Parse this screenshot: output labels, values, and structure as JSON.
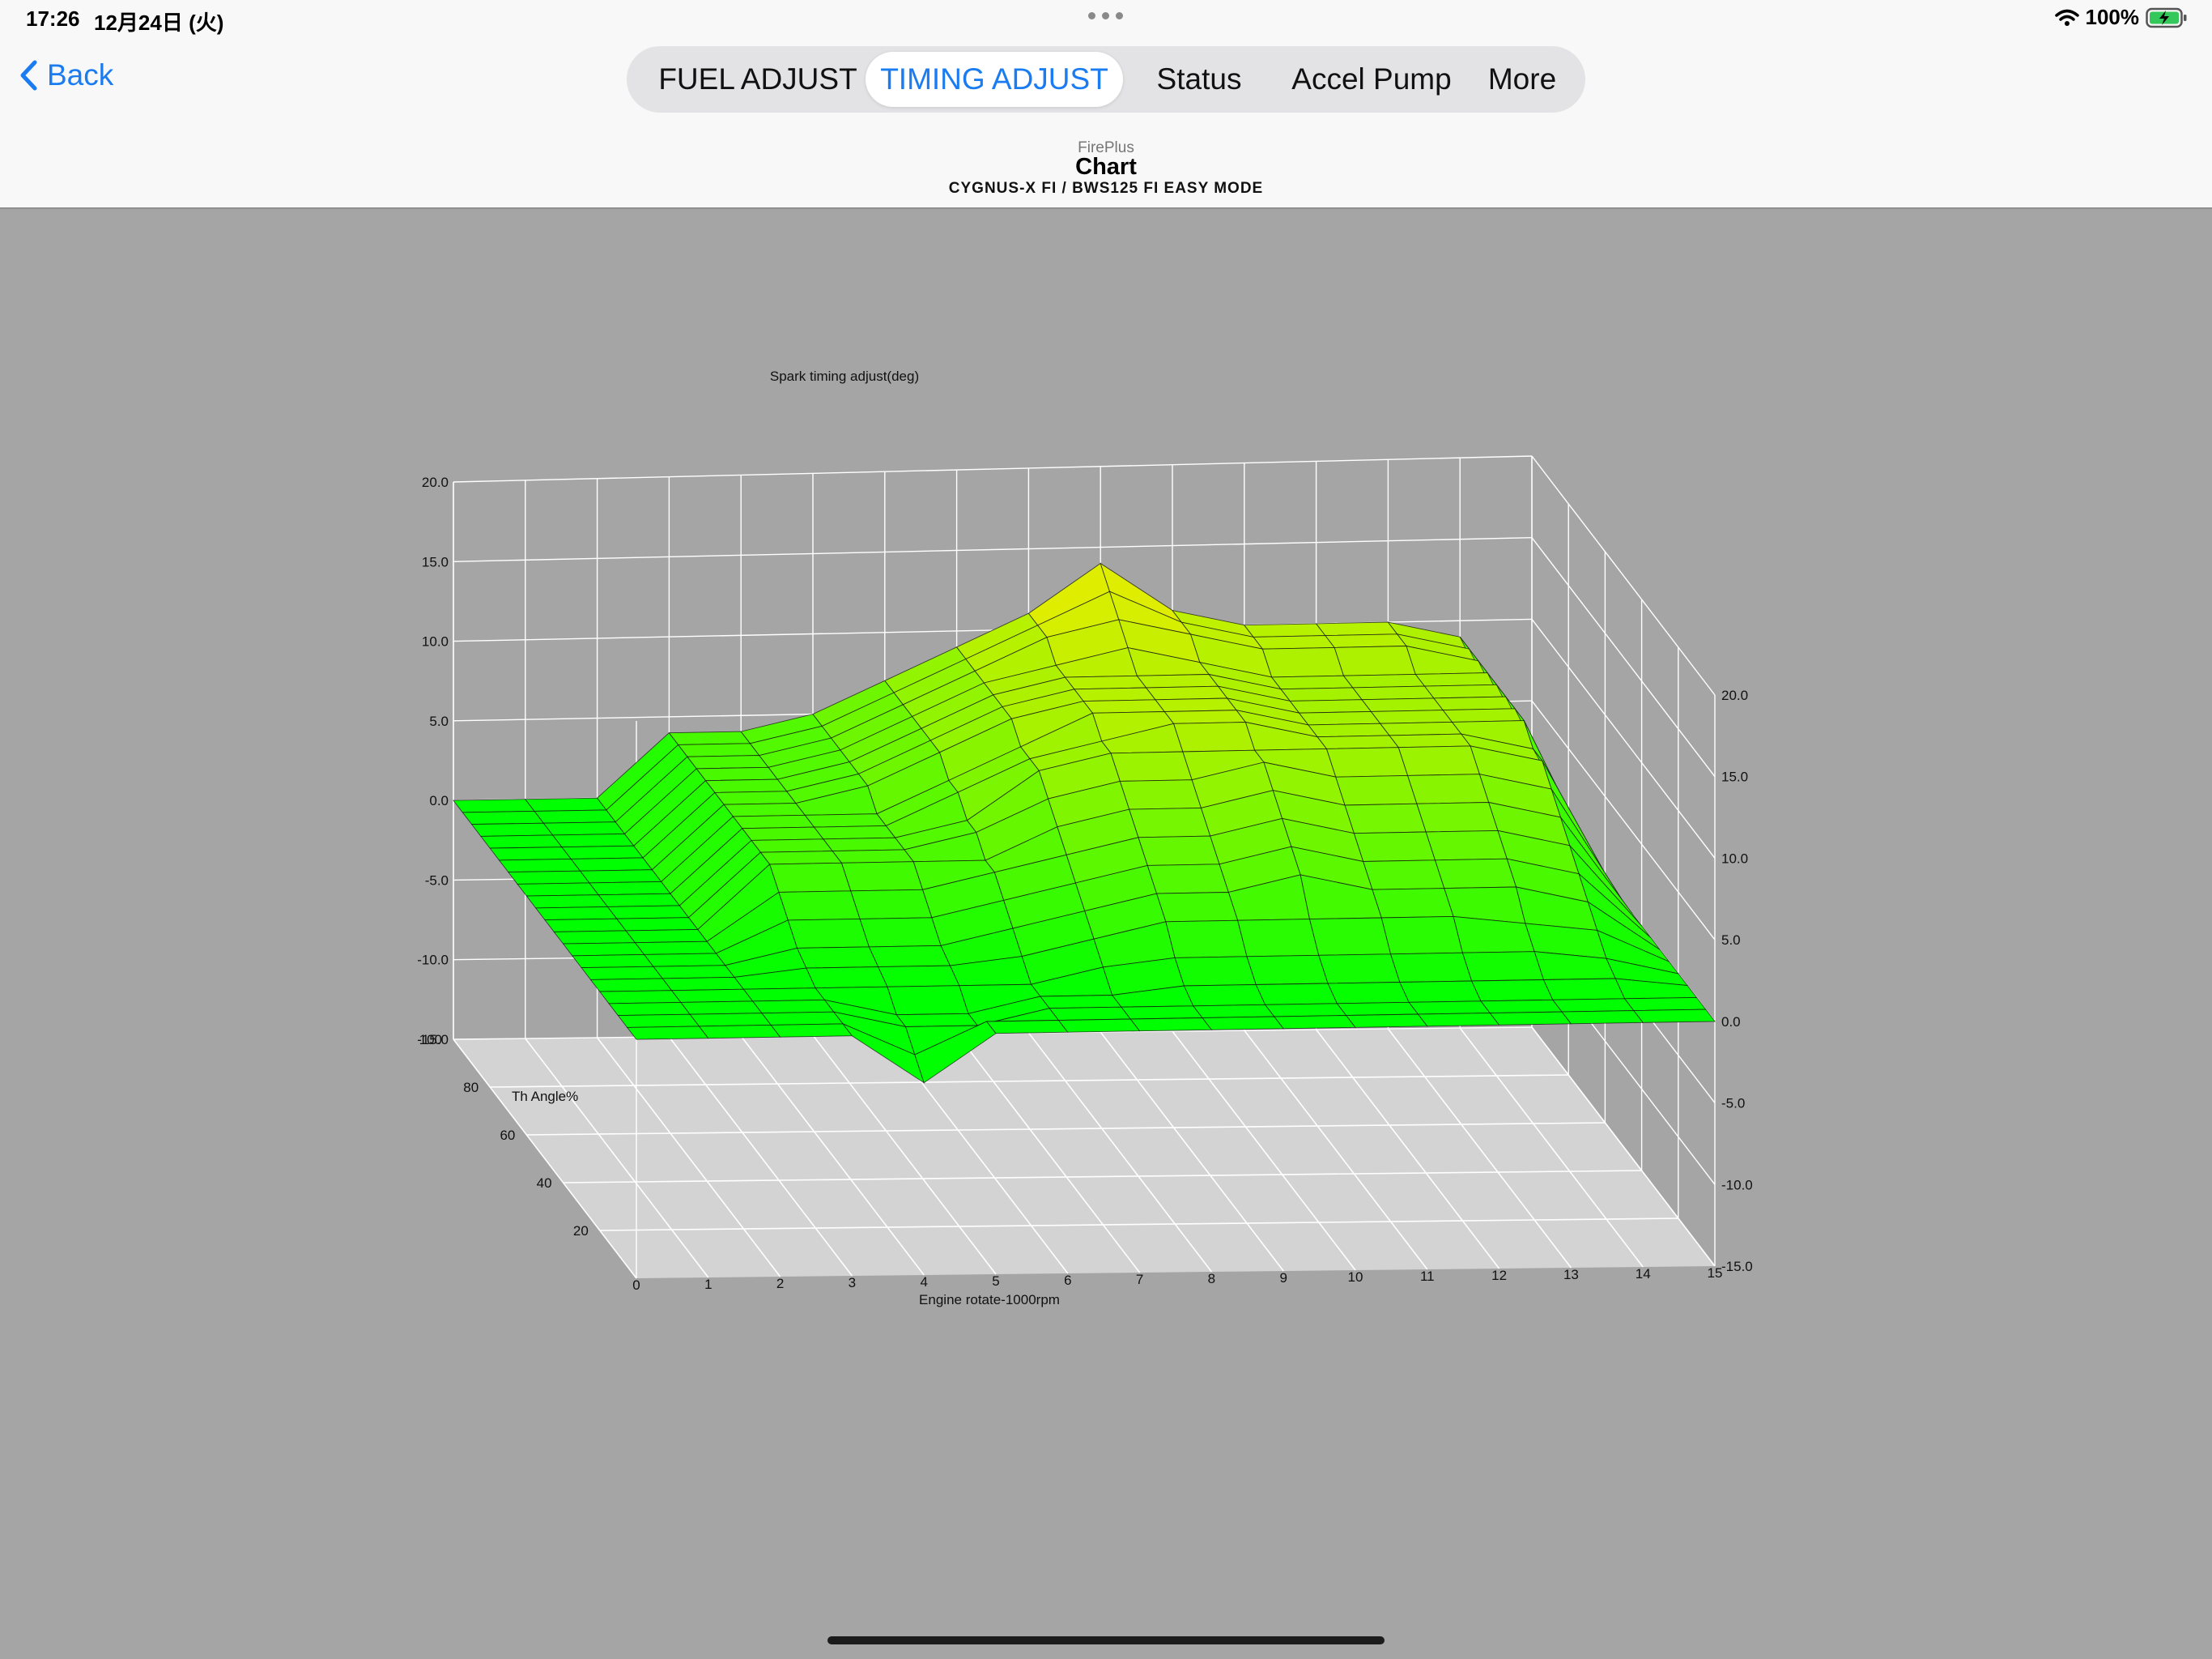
{
  "status_bar": {
    "time": "17:26",
    "date": "12月24日 (火)",
    "battery": "100%"
  },
  "nav": {
    "back_label": "Back",
    "tabs": [
      {
        "label": "FUEL ADJUST",
        "active": false
      },
      {
        "label": "TIMING ADJUST",
        "active": true
      },
      {
        "label": "Status",
        "active": false
      },
      {
        "label": "Accel Pump",
        "active": false
      },
      {
        "label": "More",
        "active": false
      }
    ]
  },
  "header": {
    "app_name": "FirePlus",
    "title": "Chart",
    "subtitle": "CYGNUS-X FI / BWS125 FI EASY MODE"
  },
  "colors": {
    "accent": "#1a7cf0",
    "surface_low": "#00ff00",
    "surface_high": "#ffee00",
    "background": "#a5a5a5"
  },
  "chart_data": {
    "type": "surface3d",
    "title": "Spark timing adjust(deg)",
    "xlabel": "Engine rotate-1000rpm",
    "ylabel": "Th Angle%",
    "zlabel": "",
    "x_ticks": [
      "0",
      "1",
      "2",
      "3",
      "4",
      "5",
      "6",
      "7",
      "8",
      "9",
      "10",
      "11",
      "12",
      "13",
      "14",
      "15"
    ],
    "y_ticks": [
      "20",
      "40",
      "60",
      "80",
      "100"
    ],
    "z_ticks_left": [
      "-15.0",
      "-10.0",
      "-5.0",
      "0.0",
      "5.0",
      "10.0",
      "15.0",
      "20.0"
    ],
    "z_ticks_right": [
      "-15.0",
      "-10.0",
      "-5.0",
      "0.0",
      "5.0",
      "10.0",
      "15.0",
      "20.0"
    ],
    "xlim": [
      0,
      15
    ],
    "ylim": [
      0,
      100
    ],
    "zlim": [
      -15,
      20
    ],
    "grid": true,
    "x": [
      0,
      1,
      2,
      3,
      4,
      5,
      6,
      7,
      8,
      9,
      10,
      11,
      12,
      13,
      14,
      15
    ],
    "y": [
      0,
      5,
      10,
      15,
      20,
      25,
      30,
      35,
      40,
      45,
      50,
      55,
      60,
      65,
      70,
      75,
      80,
      85,
      90,
      95,
      100
    ],
    "z_rows": [
      [
        0,
        0,
        0,
        0,
        -3,
        0,
        0,
        0,
        0,
        0,
        0,
        0,
        0,
        0,
        0,
        0
      ],
      [
        0,
        0,
        0,
        0,
        -2,
        0,
        0,
        0,
        0,
        0,
        0,
        0,
        0,
        0,
        0,
        0
      ],
      [
        0,
        0,
        0,
        0,
        -1,
        -1,
        0,
        0,
        0,
        0,
        0,
        0,
        0,
        0,
        0,
        0
      ],
      [
        0,
        0,
        0,
        0,
        -1,
        -1,
        0,
        0,
        0.5,
        0.5,
        0.5,
        0.5,
        0.5,
        0.5,
        0.5,
        0
      ],
      [
        0,
        0,
        0,
        0,
        0,
        0,
        0,
        1,
        1.5,
        1.5,
        1.5,
        1.5,
        1.5,
        1.5,
        1,
        0
      ],
      [
        0,
        0,
        0,
        0.5,
        0.5,
        0.5,
        1,
        2,
        3,
        3,
        3,
        3,
        3,
        2.5,
        2,
        0
      ],
      [
        0,
        0,
        0,
        1,
        1,
        1,
        2,
        3,
        4,
        4,
        5,
        4,
        4,
        4,
        3,
        0
      ],
      [
        0,
        0,
        0,
        2,
        2,
        2,
        3,
        4,
        5,
        5,
        6,
        5,
        5,
        5,
        4,
        0
      ],
      [
        0,
        0,
        0,
        3,
        3,
        3,
        4,
        5,
        6,
        6,
        7,
        6,
        6,
        6,
        5,
        0
      ],
      [
        0,
        0,
        0,
        4,
        4,
        4,
        4,
        6,
        7,
        7,
        8,
        7,
        7,
        7,
        6,
        0
      ],
      [
        0,
        0,
        0,
        4,
        4,
        4,
        5,
        7,
        8,
        8,
        9,
        8,
        8,
        8,
        7,
        0
      ],
      [
        0,
        0,
        0,
        4,
        4,
        4,
        5,
        8,
        9,
        9,
        9,
        9,
        9,
        9,
        8,
        0
      ],
      [
        0,
        0,
        0,
        4,
        4,
        4,
        6,
        8,
        9,
        10,
        10,
        9,
        9,
        9,
        8,
        0
      ],
      [
        0,
        0,
        0,
        4,
        4,
        4,
        6,
        8,
        10,
        10,
        10,
        9,
        9,
        9,
        9,
        0
      ],
      [
        0,
        0,
        0,
        4,
        4,
        5,
        7,
        9,
        10,
        10,
        10,
        9,
        9,
        9,
        9,
        0
      ],
      [
        0,
        0,
        0,
        4,
        4,
        5,
        7,
        9,
        10,
        10,
        10,
        9,
        9,
        9,
        9,
        0
      ],
      [
        0,
        0,
        0,
        4,
        4,
        5,
        7,
        9,
        10,
        10,
        10,
        9,
        9,
        9,
        9,
        0
      ],
      [
        0,
        0,
        0,
        4,
        4,
        5,
        7,
        9,
        10,
        11,
        10,
        9,
        9,
        9,
        9,
        0
      ],
      [
        0,
        0,
        0,
        4,
        4,
        5,
        7,
        9,
        11,
        12,
        11,
        10,
        10,
        10,
        9,
        0
      ],
      [
        0,
        0,
        0,
        4,
        4,
        5,
        7,
        9,
        11,
        13,
        11,
        10,
        10,
        10,
        9,
        0
      ],
      [
        0,
        0,
        0,
        4,
        4,
        5,
        7,
        9,
        11,
        14,
        11,
        10,
        10,
        10,
        9,
        0
      ]
    ]
  }
}
